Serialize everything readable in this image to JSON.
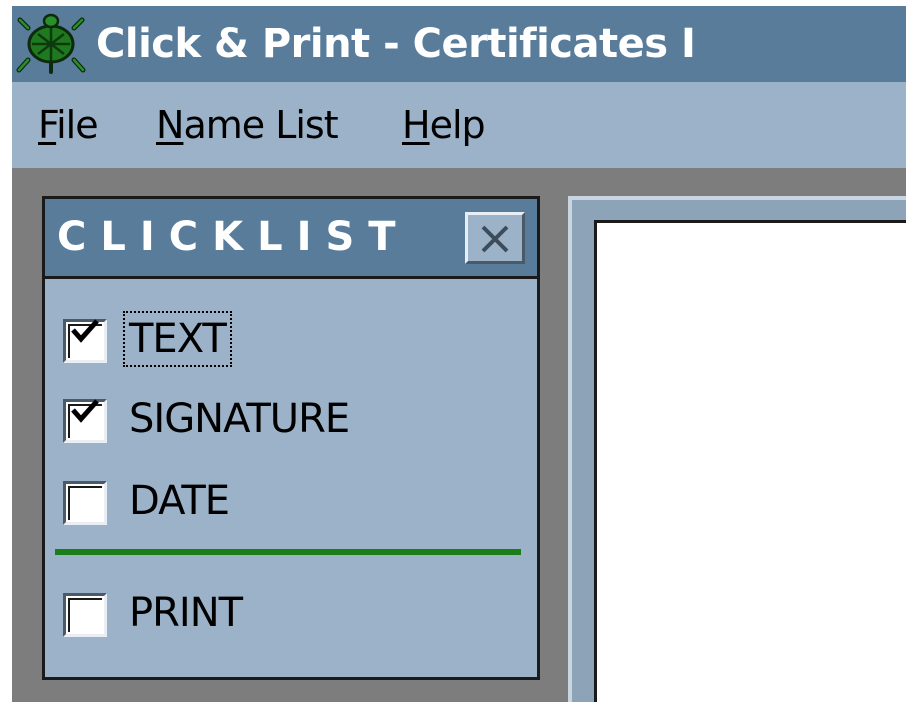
{
  "window": {
    "title": "Click & Print - Certificates I",
    "icon": "turtle-app-icon"
  },
  "menu": {
    "items": [
      {
        "label": "File",
        "mnemonic": "F",
        "rest": "ile"
      },
      {
        "label": "Name List",
        "mnemonic": "N",
        "rest": "ame List"
      },
      {
        "label": "Help",
        "mnemonic": "H",
        "rest": "elp"
      }
    ]
  },
  "clicklist": {
    "title": "CLICKLIST",
    "close_icon": "close-icon",
    "items": [
      {
        "label": "TEXT",
        "checked": true,
        "focused": true
      },
      {
        "label": "SIGNATURE",
        "checked": true,
        "focused": false
      },
      {
        "label": "DATE",
        "checked": false,
        "focused": false
      }
    ],
    "print": {
      "label": "PRINT",
      "checked": false
    }
  },
  "colors": {
    "titlebar": "#587c9a",
    "menubar": "#9bb2c8",
    "divider": "#1a7f1a",
    "workspace": "#7d7d7d"
  }
}
